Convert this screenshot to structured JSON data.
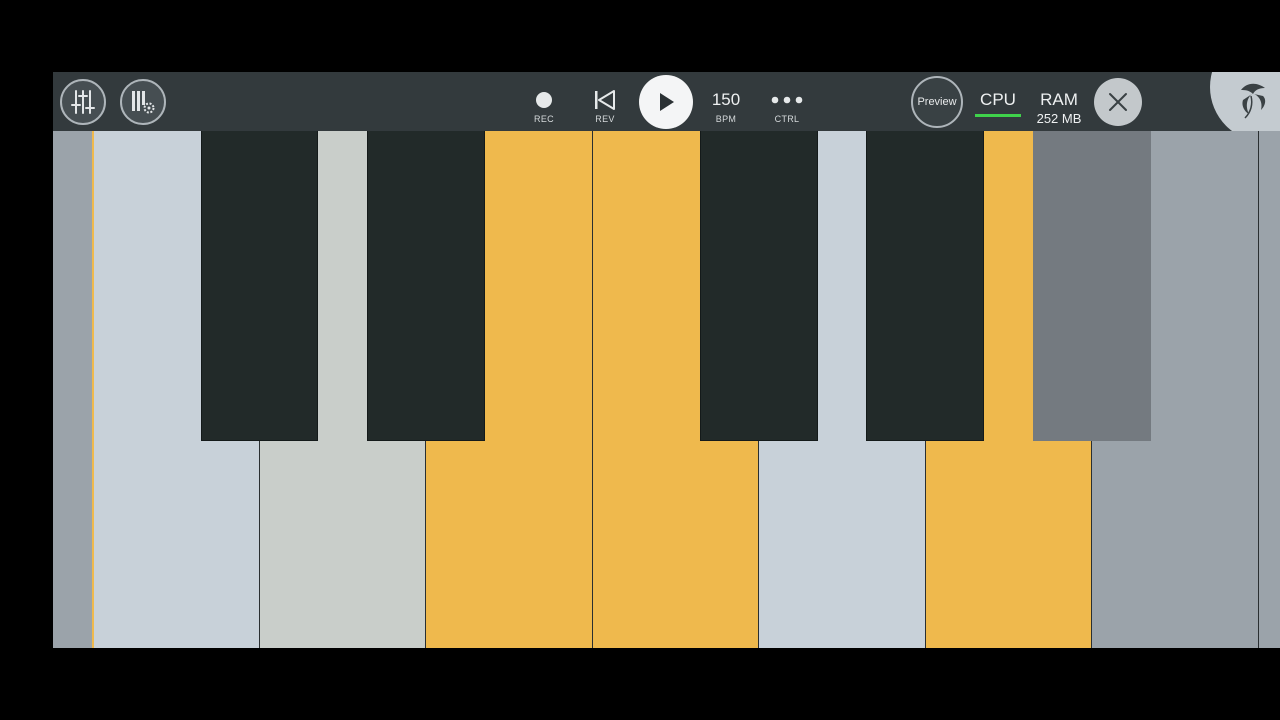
{
  "toolbar": {
    "icons": {
      "mixer": "mixer-sliders-icon",
      "piano_settings": "piano-settings-icon",
      "record": "record-icon",
      "rewind": "rewind-icon",
      "play": "play-icon",
      "ctrl": "more-dots-icon",
      "close": "close-icon",
      "logo": "fl-fruit-logo-icon"
    },
    "rec_label": "REC",
    "rev_label": "REV",
    "bpm_value": "150",
    "bpm_label": "BPM",
    "ctrl_label": "CTRL",
    "preview_label": "Preview",
    "cpu_label": "CPU",
    "ram_label": "RAM",
    "ram_value": "252 MB"
  },
  "colors": {
    "toolbar_bg": "#333a3d",
    "white_key": "#c8d1d9",
    "pressed_key": "#efb94d",
    "black_key": "#222a29",
    "inactive_key": "#9ba3aa",
    "cpu_meter": "#3fd24b"
  },
  "keyboard": {
    "white_keys": [
      "outer",
      "light",
      "light2",
      "pressed",
      "pressed",
      "light",
      "pressed",
      "dim",
      "outer"
    ],
    "black_keys": [
      "dark",
      "dark",
      "dark",
      "dark",
      "grey"
    ]
  }
}
